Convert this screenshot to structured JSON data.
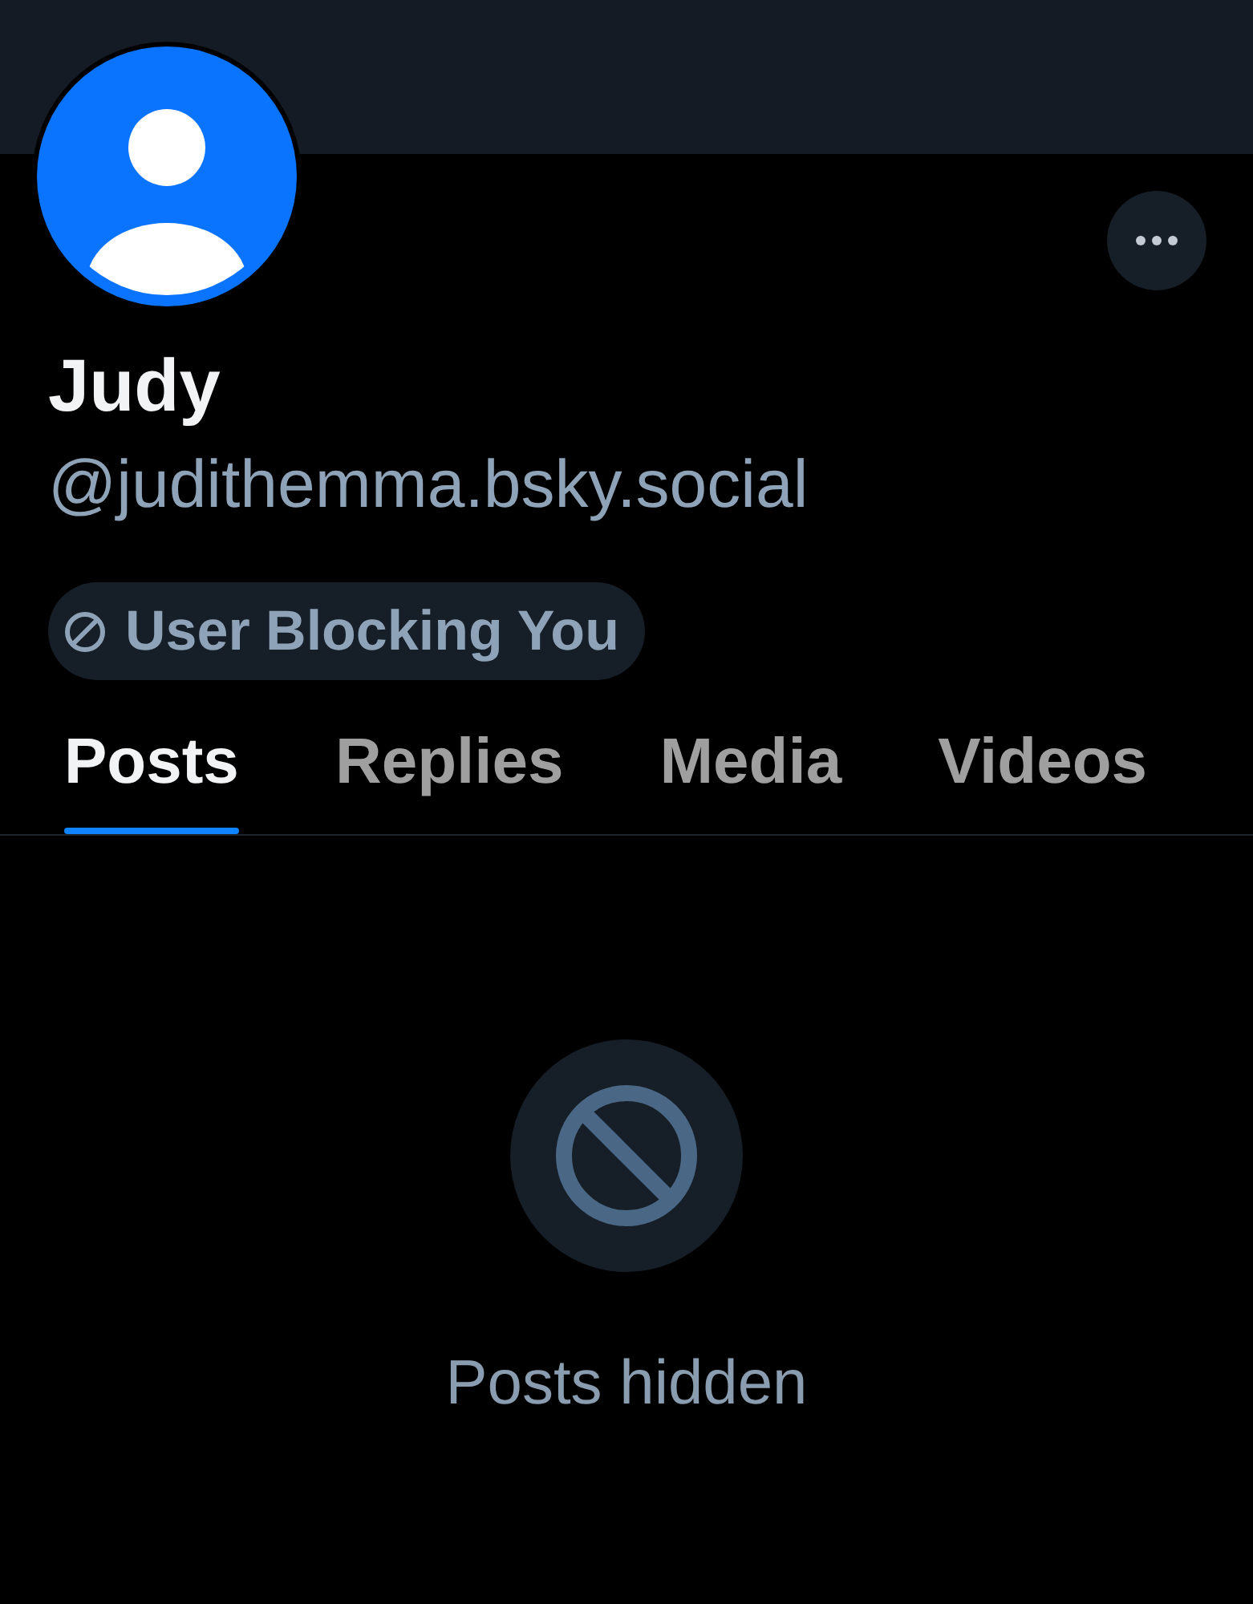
{
  "profile": {
    "name": "Judy",
    "handle": "@judithemma.bsky.social",
    "badge": {
      "label": "User Blocking You"
    }
  },
  "tabs": [
    {
      "label": "Posts",
      "selected": true
    },
    {
      "label": "Replies",
      "selected": false
    },
    {
      "label": "Media",
      "selected": false
    },
    {
      "label": "Videos",
      "selected": false
    }
  ],
  "empty_state": {
    "message": "Posts hidden"
  }
}
